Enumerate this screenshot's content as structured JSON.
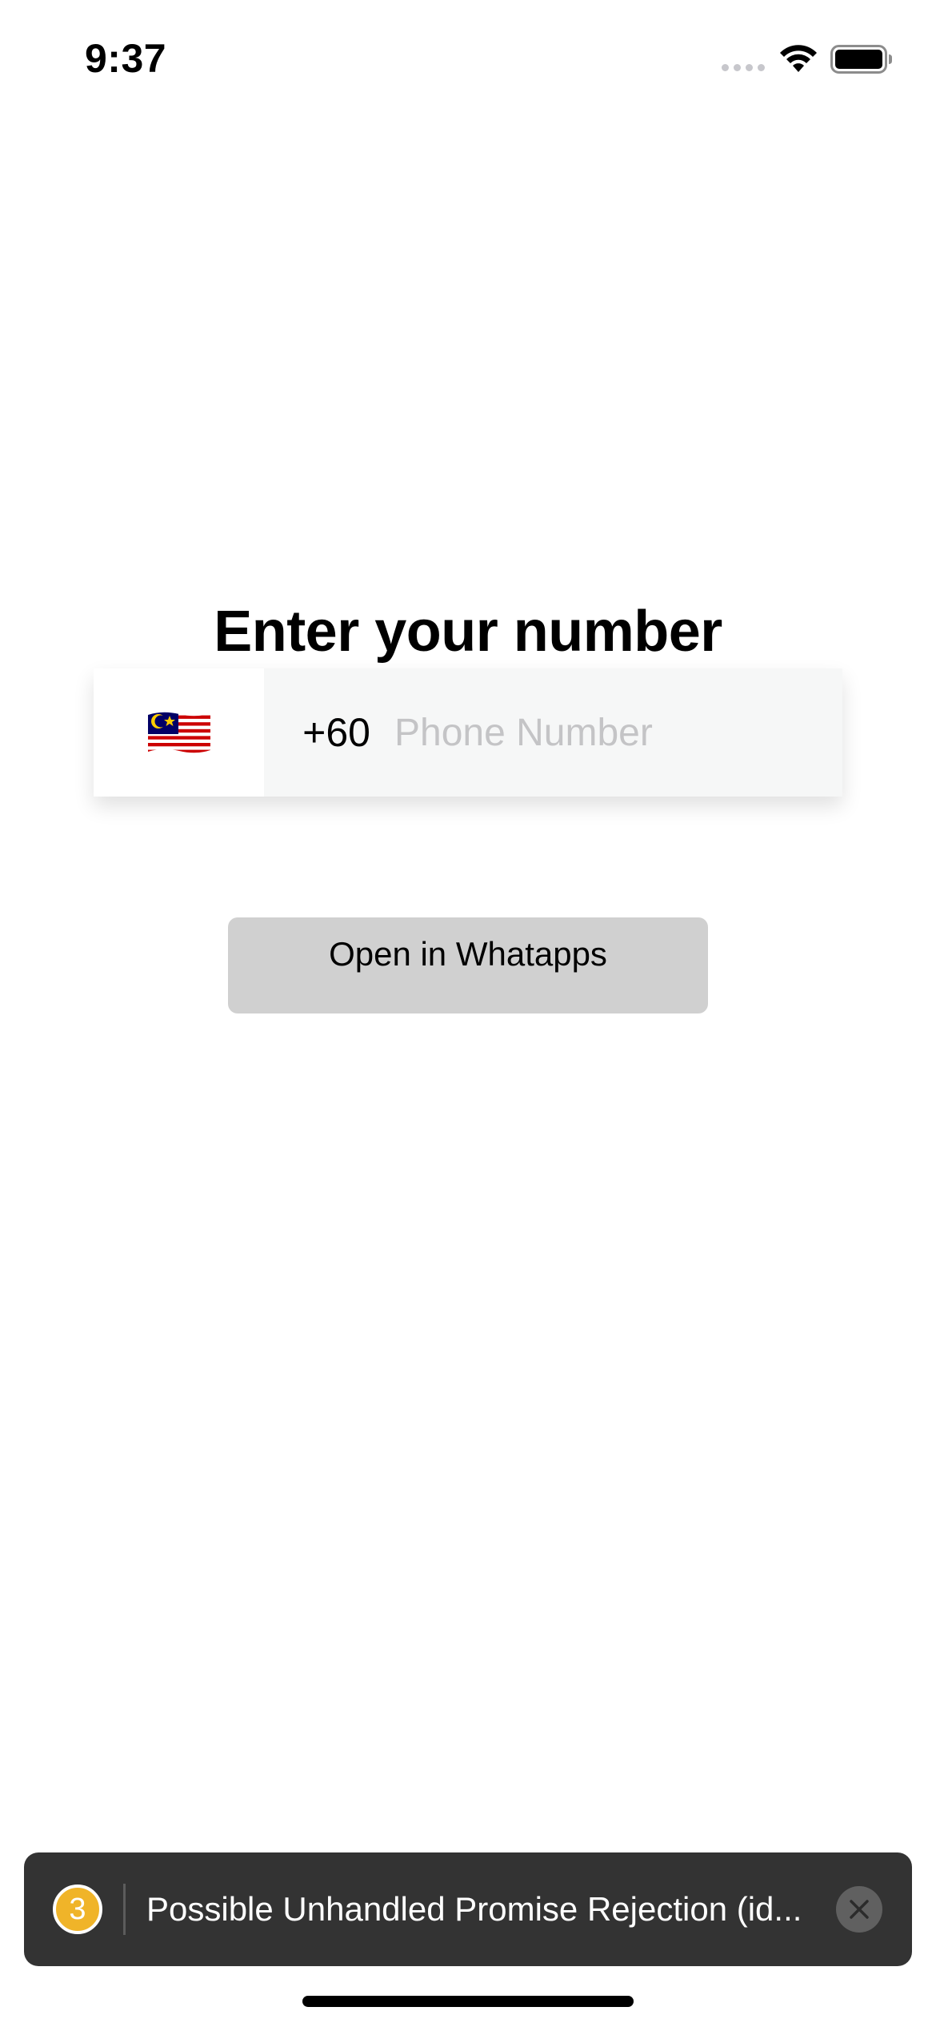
{
  "status_bar": {
    "time": "9:37",
    "icons": [
      "cellular-signal-icon",
      "wifi-icon",
      "battery-icon"
    ]
  },
  "main": {
    "title": "Enter your number",
    "country": {
      "flag_icon": "malaysia-flag-icon",
      "code": "+60"
    },
    "phone_input": {
      "value": "",
      "placeholder": "Phone Number"
    },
    "open_button_label": "Open in Whatapps"
  },
  "toast": {
    "count": "3",
    "message": "Possible Unhandled Promise Rejection (id...",
    "close_icon": "close-icon",
    "colors": {
      "background": "#333333",
      "badge": "#f0b429"
    }
  },
  "colors": {
    "button_background": "#d0d0d0",
    "input_background": "#f6f7f7",
    "placeholder": "#c4c4c6"
  }
}
